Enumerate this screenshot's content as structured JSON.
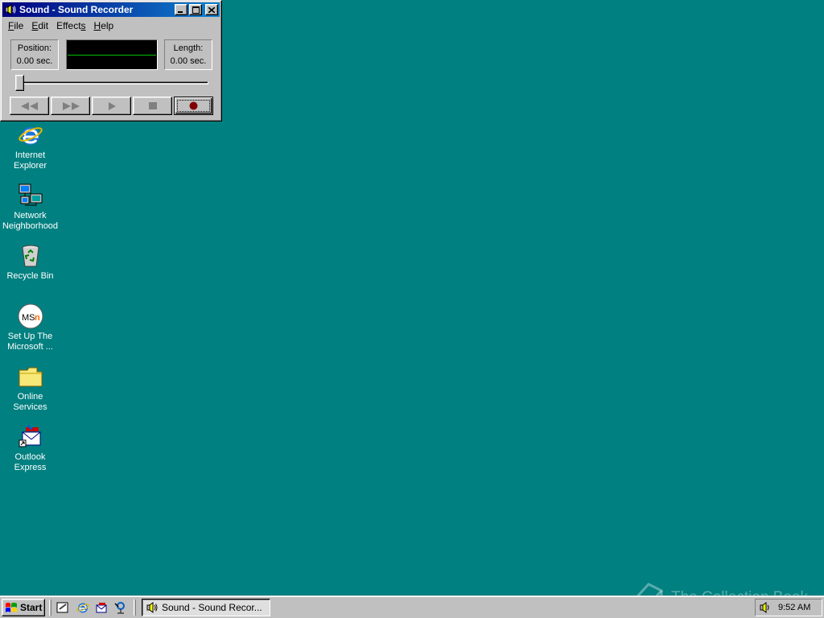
{
  "window": {
    "title": "Sound - Sound Recorder",
    "menu": {
      "file": "F",
      "file_rest": "ile",
      "edit": "E",
      "edit_rest": "dit",
      "effects": "Effects",
      "effects_u": "s",
      "help": "H",
      "help_rest": "elp"
    },
    "position_label": "Position:",
    "position_value": "0.00 sec.",
    "length_label": "Length:",
    "length_value": "0.00 sec.",
    "slider_position": 0,
    "transport": [
      "seek-to-start",
      "seek-to-end",
      "play",
      "stop",
      "record"
    ],
    "colors": {
      "wave": "#00c000",
      "record": "#800000"
    }
  },
  "desktop": {
    "icons": [
      {
        "line1": "Internet",
        "line2": "Explorer",
        "icon": "internet-explorer-icon"
      },
      {
        "line1": "Network",
        "line2": "Neighborhood",
        "icon": "network-neighborhood-icon"
      },
      {
        "line1": "Recycle Bin",
        "line2": "",
        "icon": "recycle-bin-icon"
      },
      {
        "line1": "Set Up The",
        "line2": "Microsoft ...",
        "icon": "msn-icon"
      },
      {
        "line1": "Online",
        "line2": "Services",
        "icon": "folder-icon"
      },
      {
        "line1": "Outlook",
        "line2": "Express",
        "icon": "outlook-express-icon"
      }
    ],
    "background": "#008080"
  },
  "taskbar": {
    "start_label": "Start",
    "task_label": "Sound - Sound Recor...",
    "clock": "9:52 AM"
  },
  "watermark": "The Collection Book"
}
